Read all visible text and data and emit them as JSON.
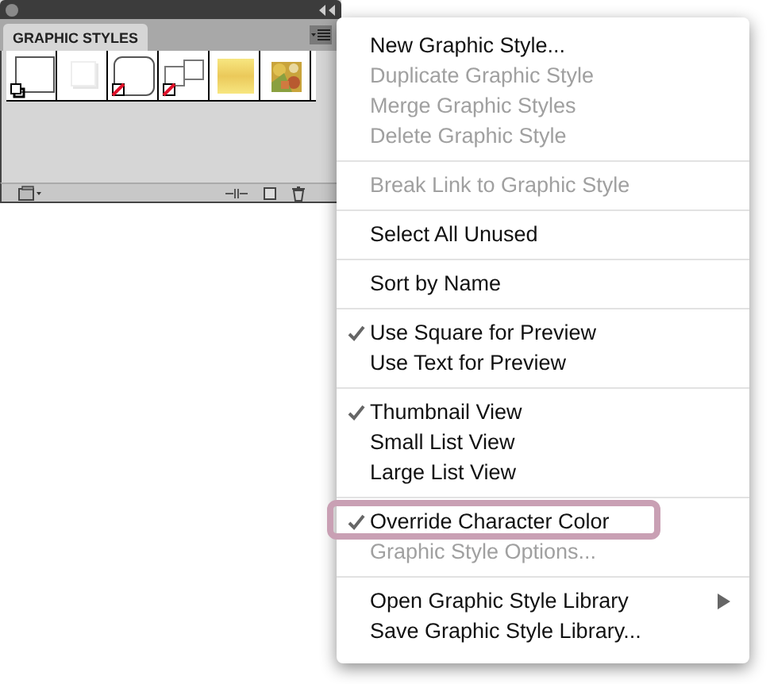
{
  "panel": {
    "tab": {
      "label": "GRAPHIC STYLES",
      "selected": true
    },
    "swatches": [
      {
        "kind": "default"
      },
      {
        "kind": "shadow"
      },
      {
        "kind": "rounded"
      },
      {
        "kind": "double"
      },
      {
        "kind": "gradient"
      },
      {
        "kind": "picture"
      }
    ]
  },
  "menu": {
    "groups": [
      [
        {
          "label": "New Graphic Style...",
          "disabled": false,
          "checked": false
        },
        {
          "label": "Duplicate Graphic Style",
          "disabled": true,
          "checked": false
        },
        {
          "label": "Merge Graphic Styles",
          "disabled": true,
          "checked": false
        },
        {
          "label": "Delete Graphic Style",
          "disabled": true,
          "checked": false
        }
      ],
      [
        {
          "label": "Break Link to Graphic Style",
          "disabled": true,
          "checked": false
        }
      ],
      [
        {
          "label": "Select All Unused",
          "disabled": false,
          "checked": false
        }
      ],
      [
        {
          "label": "Sort by Name",
          "disabled": false,
          "checked": false
        }
      ],
      [
        {
          "label": "Use Square for Preview",
          "disabled": false,
          "checked": true
        },
        {
          "label": "Use Text for Preview",
          "disabled": false,
          "checked": false
        }
      ],
      [
        {
          "label": "Thumbnail View",
          "disabled": false,
          "checked": true
        },
        {
          "label": "Small List View",
          "disabled": false,
          "checked": false
        },
        {
          "label": "Large List View",
          "disabled": false,
          "checked": false
        }
      ],
      [
        {
          "label": "Override Character Color",
          "disabled": false,
          "checked": true,
          "highlighted": true
        },
        {
          "label": "Graphic Style Options...",
          "disabled": true,
          "checked": false
        }
      ],
      [
        {
          "label": "Open Graphic Style Library",
          "disabled": false,
          "checked": false,
          "submenu": true
        },
        {
          "label": "Save Graphic Style Library...",
          "disabled": false,
          "checked": false
        }
      ]
    ]
  }
}
